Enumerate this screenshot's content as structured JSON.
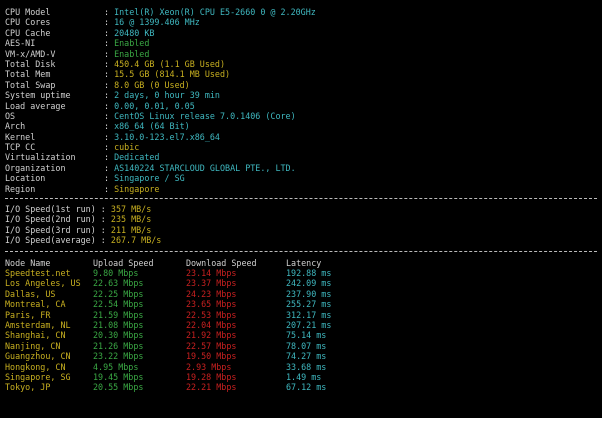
{
  "colors": {
    "background": "#000000",
    "cyan": "#3fb8c0",
    "green": "#3aa844",
    "yellow": "#c8b020",
    "red": "#c82020",
    "white": "#d0d0d0"
  },
  "info": [
    {
      "key": "CPU Model",
      "sep": ": ",
      "value": "Intel(R) Xeon(R) CPU E5-2660 0 @ 2.20GHz",
      "color": "cyan"
    },
    {
      "key": "CPU Cores",
      "sep": ": ",
      "value": "16 @ 1399.406 MHz",
      "color": "cyan"
    },
    {
      "key": "CPU Cache",
      "sep": ": ",
      "value": "20480 KB",
      "color": "cyan"
    },
    {
      "key": "AES-NI",
      "sep": ": ",
      "value": "Enabled",
      "color": "green"
    },
    {
      "key": "VM-x/AMD-V",
      "sep": ": ",
      "value": "Enabled",
      "color": "green"
    },
    {
      "key": "Total Disk",
      "sep": ": ",
      "value": "450.4 GB (1.1 GB Used)",
      "color": "yellow"
    },
    {
      "key": "Total Mem",
      "sep": ": ",
      "value": "15.5 GB (814.1 MB Used)",
      "color": "yellow"
    },
    {
      "key": "Total Swap",
      "sep": ": ",
      "value": "8.0 GB (0 Used)",
      "color": "yellow"
    },
    {
      "key": "System uptime",
      "sep": ": ",
      "value": "2 days, 0 hour 39 min",
      "color": "cyan"
    },
    {
      "key": "Load average",
      "sep": ": ",
      "value": "0.00, 0.01, 0.05",
      "color": "cyan"
    },
    {
      "key": "OS",
      "sep": ": ",
      "value": "CentOS Linux release 7.0.1406 (Core)",
      "color": "cyan"
    },
    {
      "key": "Arch",
      "sep": ": ",
      "value": "x86_64 (64 Bit)",
      "color": "cyan"
    },
    {
      "key": "Kernel",
      "sep": ": ",
      "value": "3.10.0-123.el7.x86_64",
      "color": "cyan"
    },
    {
      "key": "TCP CC",
      "sep": ": ",
      "value": "cubic",
      "color": "yellow"
    },
    {
      "key": "Virtualization",
      "sep": ": ",
      "value": "Dedicated",
      "color": "cyan"
    },
    {
      "key": "Organization",
      "sep": ": ",
      "value": "AS140224 STARCLOUD GLOBAL PTE., LTD.",
      "color": "cyan"
    },
    {
      "key": "Location",
      "sep": ": ",
      "value": "Singapore / SG",
      "color": "cyan"
    },
    {
      "key": "Region",
      "sep": ": ",
      "value": "Singapore",
      "color": "yellow"
    }
  ],
  "io": [
    {
      "key": "I/O Speed(1st run)",
      "sep": " : ",
      "value": "357 MB/s"
    },
    {
      "key": "I/O Speed(2nd run)",
      "sep": " : ",
      "value": "235 MB/s"
    },
    {
      "key": "I/O Speed(3rd run)",
      "sep": " : ",
      "value": "211 MB/s"
    },
    {
      "key": "I/O Speed(average)",
      "sep": " : ",
      "value": "267.7 MB/s"
    }
  ],
  "speed_headers": [
    "Node Name",
    "Upload Speed",
    "Download Speed",
    "Latency"
  ],
  "speed": [
    {
      "node": "Speedtest.net",
      "up": "9.80 Mbps",
      "down": "23.14 Mbps",
      "lat": "192.88 ms"
    },
    {
      "node": "Los Angeles, US",
      "up": "22.63 Mbps",
      "down": "23.37 Mbps",
      "lat": "242.09 ms"
    },
    {
      "node": "Dallas, US",
      "up": "22.25 Mbps",
      "down": "24.23 Mbps",
      "lat": "237.90 ms"
    },
    {
      "node": "Montreal, CA",
      "up": "22.54 Mbps",
      "down": "23.65 Mbps",
      "lat": "255.27 ms"
    },
    {
      "node": "Paris, FR",
      "up": "21.59 Mbps",
      "down": "22.53 Mbps",
      "lat": "312.17 ms"
    },
    {
      "node": "Amsterdam, NL",
      "up": "21.08 Mbps",
      "down": "22.04 Mbps",
      "lat": "207.21 ms"
    },
    {
      "node": "Shanghai, CN",
      "up": "20.30 Mbps",
      "down": "21.92 Mbps",
      "lat": "75.14 ms"
    },
    {
      "node": "Nanjing, CN",
      "up": "21.26 Mbps",
      "down": "22.57 Mbps",
      "lat": "78.07 ms"
    },
    {
      "node": "Guangzhou, CN",
      "up": "23.22 Mbps",
      "down": "19.50 Mbps",
      "lat": "74.27 ms"
    },
    {
      "node": "Hongkong, CN",
      "up": "4.95 Mbps",
      "down": "2.93 Mbps",
      "lat": "33.68 ms"
    },
    {
      "node": "Singapore, SG",
      "up": "19.45 Mbps",
      "down": "19.28 Mbps",
      "lat": "1.49 ms"
    },
    {
      "node": "Tokyo, JP",
      "up": "20.55 Mbps",
      "down": "22.21 Mbps",
      "lat": "67.12 ms"
    }
  ]
}
